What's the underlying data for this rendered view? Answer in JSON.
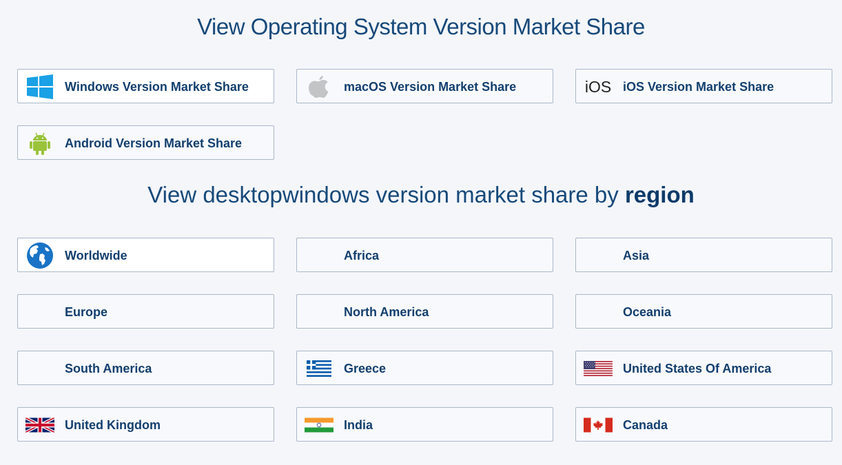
{
  "os_section": {
    "heading": "View Operating System Version Market Share",
    "items": [
      {
        "label": "Windows Version Market Share",
        "icon": "windows-logo-icon"
      },
      {
        "label": "macOS Version Market Share",
        "icon": "apple-logo-icon"
      },
      {
        "label": "iOS Version Market Share",
        "icon": "ios-logo-icon",
        "icon_text": "iOS"
      },
      {
        "label": "Android Version Market Share",
        "icon": "android-logo-icon"
      }
    ]
  },
  "region_section": {
    "heading_prefix": "View desktopwindows version market share by",
    "heading_bold": "region",
    "items": [
      {
        "label": "Worldwide",
        "icon": "globe-icon"
      },
      {
        "label": "Africa"
      },
      {
        "label": "Asia"
      },
      {
        "label": "Europe"
      },
      {
        "label": "North America"
      },
      {
        "label": "Oceania"
      },
      {
        "label": "South America"
      },
      {
        "label": "Greece",
        "icon": "greece-flag-icon"
      },
      {
        "label": "United States Of America",
        "icon": "usa-flag-icon"
      },
      {
        "label": "United Kingdom",
        "icon": "uk-flag-icon"
      },
      {
        "label": "India",
        "icon": "india-flag-icon"
      },
      {
        "label": "Canada",
        "icon": "canada-flag-icon"
      }
    ]
  },
  "colors": {
    "heading": "#17497a",
    "label": "#133f6e",
    "border": "#aab8c8",
    "background": "#f4f6fa"
  }
}
